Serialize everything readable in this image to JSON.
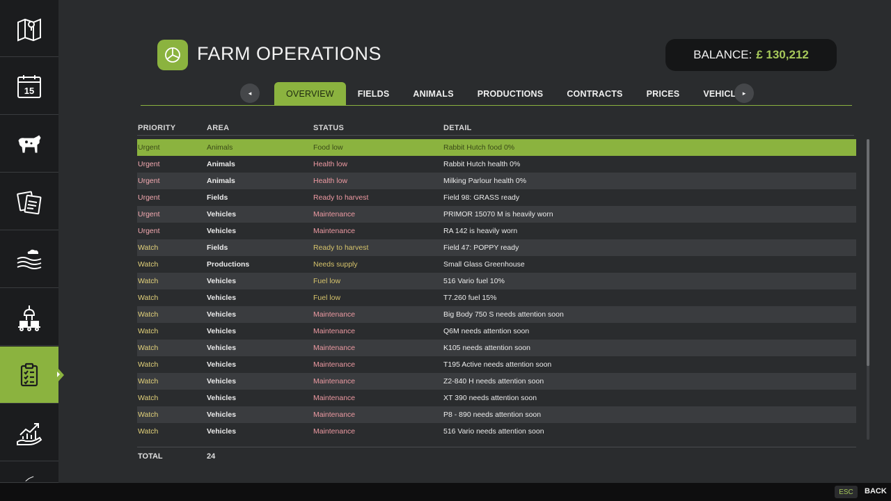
{
  "sidebar": {
    "items": [
      {
        "name": "map-icon"
      },
      {
        "name": "calendar-icon",
        "badge": "15"
      },
      {
        "name": "animals-cow-icon"
      },
      {
        "name": "contracts-documents-icon"
      },
      {
        "name": "weather-icon"
      },
      {
        "name": "production-factory-icon"
      },
      {
        "name": "farm-operations-clipboard-icon",
        "active": true
      },
      {
        "name": "finances-chart-icon"
      }
    ]
  },
  "header": {
    "title": "FARM OPERATIONS",
    "balance_label": "BALANCE:",
    "balance_value": "£ 130,212"
  },
  "tabs": {
    "prev_icon": "◂",
    "next_icon": "▸",
    "items": [
      {
        "label": "OVERVIEW",
        "active": true
      },
      {
        "label": "FIELDS"
      },
      {
        "label": "ANIMALS"
      },
      {
        "label": "PRODUCTIONS"
      },
      {
        "label": "CONTRACTS"
      },
      {
        "label": "PRICES"
      },
      {
        "label": "VEHICLES"
      }
    ]
  },
  "table": {
    "columns": {
      "priority": "PRIORITY",
      "area": "AREA",
      "status": "STATUS",
      "detail": "DETAIL"
    },
    "rows": [
      {
        "priority": "Urgent",
        "area": "Animals",
        "status": "Food low",
        "detail": "Rabbit Hutch food 0%"
      },
      {
        "priority": "Urgent",
        "area": "Animals",
        "status": "Health low",
        "detail": "Rabbit Hutch health 0%"
      },
      {
        "priority": "Urgent",
        "area": "Animals",
        "status": "Health low",
        "detail": "Milking Parlour health 0%"
      },
      {
        "priority": "Urgent",
        "area": "Fields",
        "status": "Ready to harvest",
        "detail": "Field 98: GRASS ready"
      },
      {
        "priority": "Urgent",
        "area": "Vehicles",
        "status": "Maintenance",
        "detail": "PRIMOR 15070 M is heavily worn"
      },
      {
        "priority": "Urgent",
        "area": "Vehicles",
        "status": "Maintenance",
        "detail": "RA 142 is heavily worn"
      },
      {
        "priority": "Watch",
        "area": "Fields",
        "status": "Ready to harvest",
        "detail": "Field 47: POPPY ready"
      },
      {
        "priority": "Watch",
        "area": "Productions",
        "status": "Needs supply",
        "detail": "Small Glass Greenhouse"
      },
      {
        "priority": "Watch",
        "area": "Vehicles",
        "status": "Fuel low",
        "detail": "516 Vario fuel 10%"
      },
      {
        "priority": "Watch",
        "area": "Vehicles",
        "status": "Fuel low",
        "detail": "T7.260 fuel 15%"
      },
      {
        "priority": "Watch",
        "area": "Vehicles",
        "status": "Maintenance",
        "detail": "Big Body 750 S needs attention soon"
      },
      {
        "priority": "Watch",
        "area": "Vehicles",
        "status": "Maintenance",
        "detail": "Q6M needs attention soon"
      },
      {
        "priority": "Watch",
        "area": "Vehicles",
        "status": "Maintenance",
        "detail": "K105 needs attention soon"
      },
      {
        "priority": "Watch",
        "area": "Vehicles",
        "status": "Maintenance",
        "detail": "T195 Active needs attention soon"
      },
      {
        "priority": "Watch",
        "area": "Vehicles",
        "status": "Maintenance",
        "detail": "Z2-840 H needs attention soon"
      },
      {
        "priority": "Watch",
        "area": "Vehicles",
        "status": "Maintenance",
        "detail": "XT 390 needs attention soon"
      },
      {
        "priority": "Watch",
        "area": "Vehicles",
        "status": "Maintenance",
        "detail": "P8 - 890 needs attention soon"
      },
      {
        "priority": "Watch",
        "area": "Vehicles",
        "status": "Maintenance",
        "detail": "516 Vario needs attention soon"
      }
    ],
    "total_label": "TOTAL",
    "total_value": "24"
  },
  "footer": {
    "esc_key": "ESC",
    "back_label": "BACK"
  },
  "colors": {
    "accent": "#8bb33f",
    "urgent": "#f3a9b0",
    "watch": "#e2d17a",
    "balance": "#a6c85a"
  }
}
